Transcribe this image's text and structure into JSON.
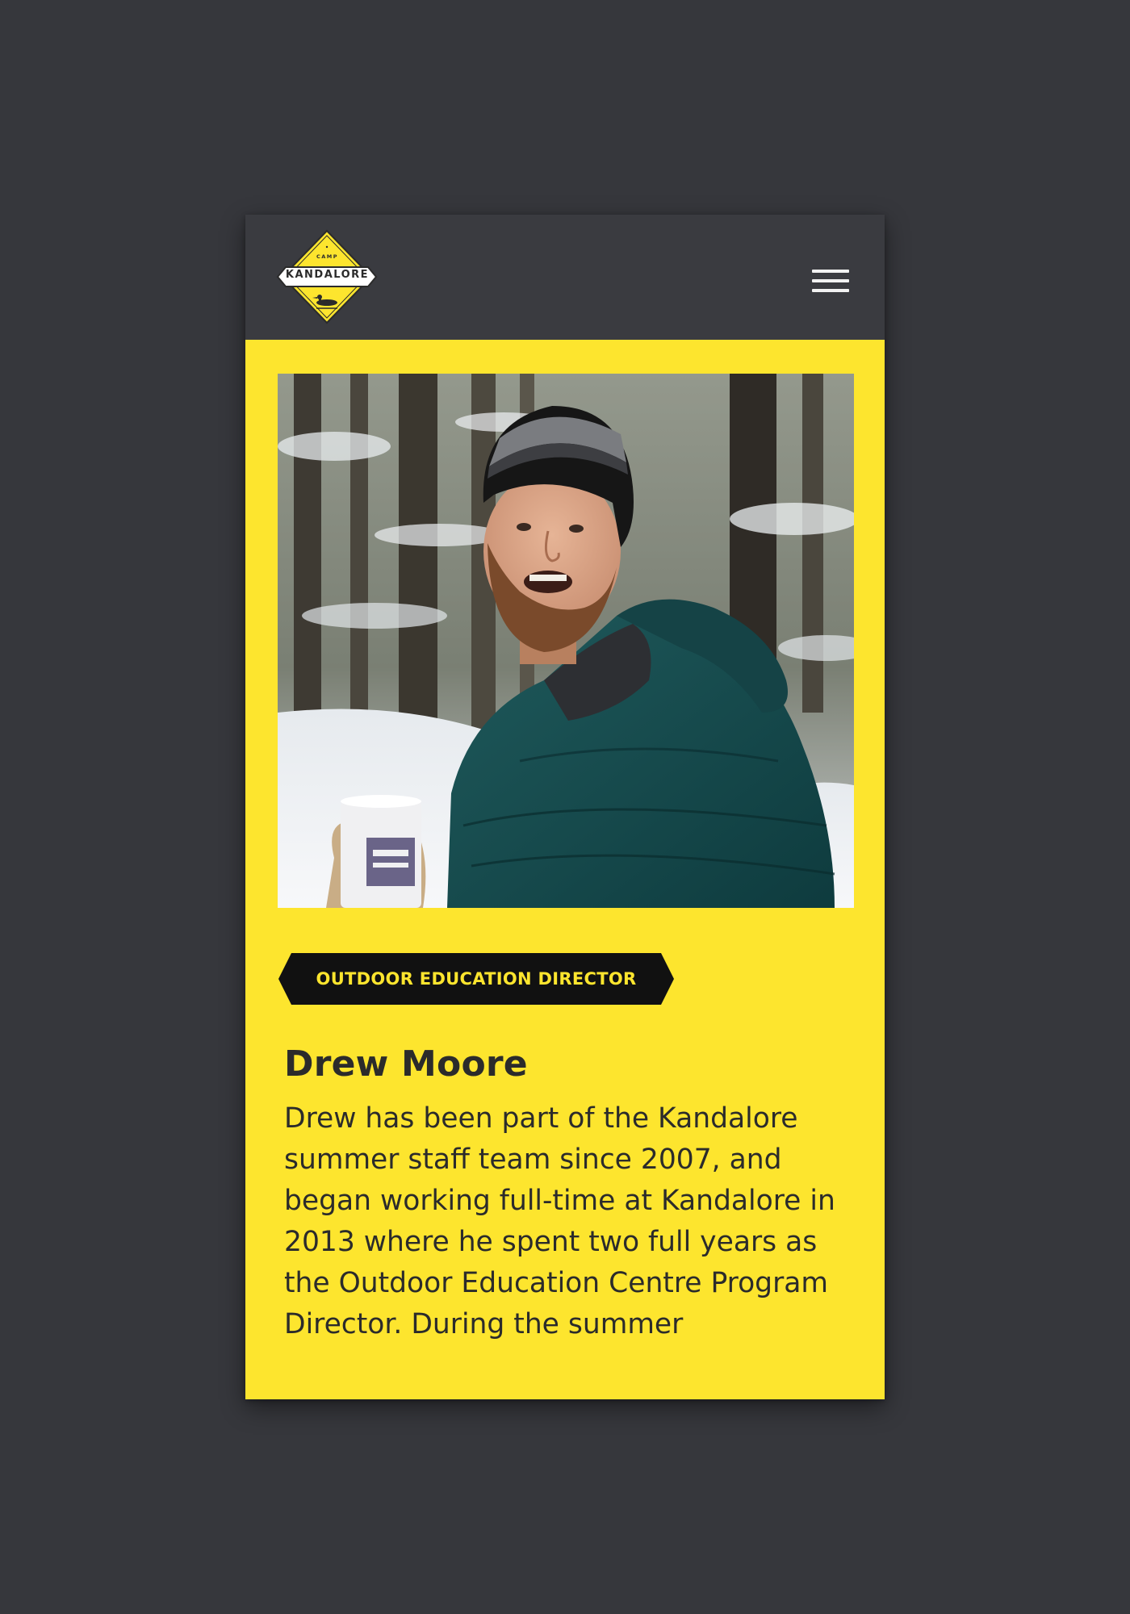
{
  "header": {
    "logo": {
      "top_text": "CAMP",
      "name": "KANDALORE",
      "icon": "loon-icon"
    },
    "menu_icon": "hamburger-menu-icon"
  },
  "profile": {
    "photo_icon": "staff-portrait-photo",
    "role": "OUTDOOR EDUCATION DIRECTOR",
    "name": "Drew Moore",
    "bio": "Drew has been part of the Kandalore summer staff team since 2007, and began working full-time at Kandalore in 2013 where he spent two full years as the Outdoor Education Centre Program Director. During the summer"
  },
  "colors": {
    "page_background": "#36373c",
    "header_background": "#3a3b40",
    "brand_yellow": "#fde52e",
    "text_dark": "#2b2b2b",
    "badge_background": "#111111"
  }
}
